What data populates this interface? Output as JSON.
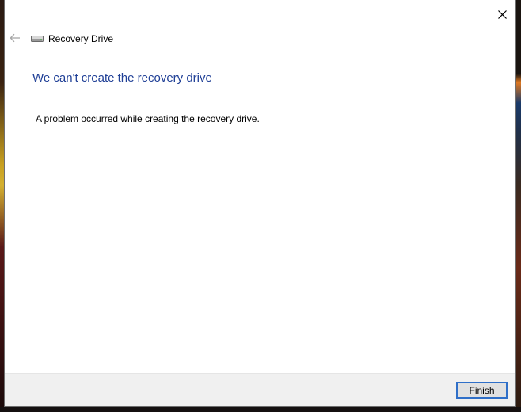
{
  "window": {
    "app_title": "Recovery Drive",
    "close_label": "✕"
  },
  "content": {
    "heading": "We can't create the recovery drive",
    "message": "A problem occurred while creating the recovery drive."
  },
  "footer": {
    "finish_label": "Finish"
  },
  "colors": {
    "heading": "#1f3f96",
    "button_focus_border": "#2f6fc8",
    "footer_bg": "#f0f0f0"
  },
  "icons": {
    "back": "back-arrow-icon",
    "drive": "drive-icon",
    "close": "close-icon"
  }
}
